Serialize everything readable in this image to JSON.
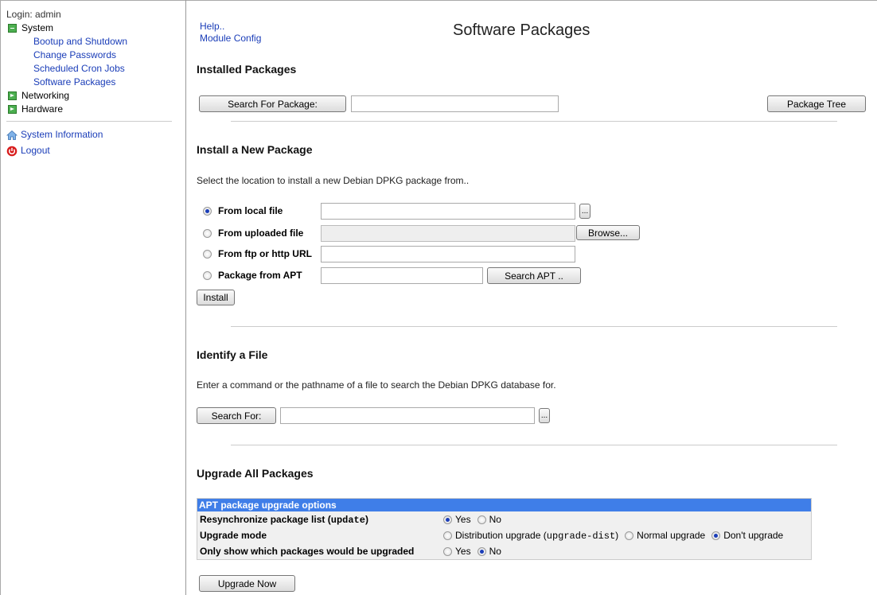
{
  "sidebar": {
    "login": "Login: admin",
    "categories": [
      {
        "label": "System",
        "open": true
      },
      {
        "label": "Networking",
        "open": false
      },
      {
        "label": "Hardware",
        "open": false
      }
    ],
    "system_items": [
      "Bootup and Shutdown",
      "Change Passwords",
      "Scheduled Cron Jobs",
      "Software Packages"
    ],
    "system_info": "System Information",
    "logout": "Logout"
  },
  "header": {
    "help": "Help..",
    "module_config": "Module Config",
    "title": "Software Packages"
  },
  "installed": {
    "heading": "Installed Packages",
    "search_button": "Search For Package:",
    "search_value": "",
    "tree_button": "Package Tree"
  },
  "install": {
    "heading": "Install a New Package",
    "description": "Select the location to install a new Debian DPKG package from..",
    "options": [
      {
        "label": "From local file",
        "selected": true
      },
      {
        "label": "From uploaded file",
        "selected": false
      },
      {
        "label": "From ftp or http URL",
        "selected": false
      },
      {
        "label": "Package from APT",
        "selected": false
      }
    ],
    "browse_button": "Browse...",
    "chooser_button": "...",
    "search_apt_button": "Search APT ..",
    "install_button": "Install"
  },
  "identify": {
    "heading": "Identify a File",
    "description": "Enter a command or the pathname of a file to search the Debian DPKG database for.",
    "search_button": "Search For:",
    "chooser_button": "..."
  },
  "upgrade": {
    "heading": "Upgrade All Packages",
    "table_title": "APT package upgrade options",
    "resync_label": "Resynchronize package list",
    "resync_code": "update",
    "mode_label": "Upgrade mode",
    "show_label": "Only show which packages would be upgraded",
    "yes": "Yes",
    "no": "No",
    "mode_dist": "Distribution upgrade",
    "mode_dist_code": "upgrade-dist",
    "mode_normal": "Normal upgrade",
    "mode_none": "Don't upgrade",
    "upgrade_button": "Upgrade Now"
  }
}
